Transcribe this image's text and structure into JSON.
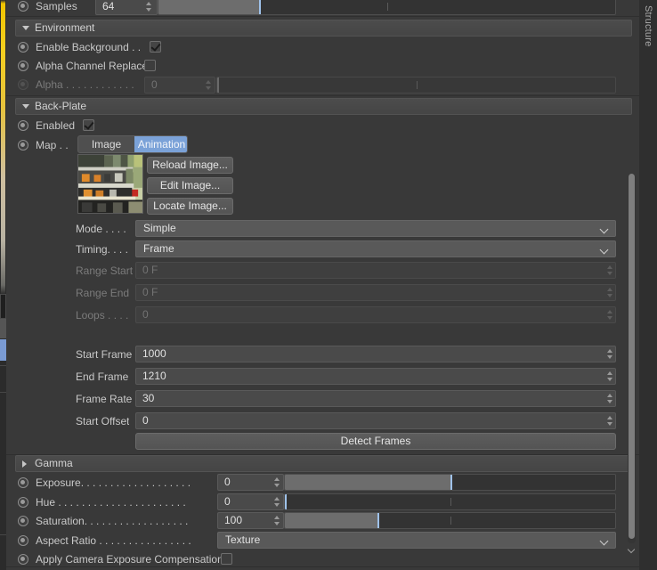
{
  "window": {
    "right_tab_label": "Structure"
  },
  "top_row": {
    "label": "Samples",
    "value": "64",
    "slider_percent": 22
  },
  "environment": {
    "group_label": "Environment",
    "rows": [
      {
        "label": "Enable Background . .",
        "checked": true
      },
      {
        "label": "Alpha Channel Replace",
        "checked": false
      }
    ],
    "alpha": {
      "label": "Alpha . . . . . . . . . . . .",
      "value": "0",
      "slider_percent": 0,
      "enabled": false
    }
  },
  "back_plate": {
    "group_label": "Back-Plate",
    "enabled": {
      "label": "Enabled",
      "checked": true
    },
    "map": {
      "label": "Map . .",
      "tabs": [
        {
          "label": "Image",
          "active": false
        },
        {
          "label": "Animation",
          "active": true
        }
      ]
    },
    "image_buttons": [
      "Reload Image...",
      "Edit Image...",
      "Locate Image..."
    ],
    "fields": [
      {
        "label": "Mode . . . .",
        "type": "dropdown",
        "value": "Simple",
        "enabled": true
      },
      {
        "label": "Timing. . . .",
        "type": "dropdown",
        "value": "Frame",
        "enabled": true
      },
      {
        "label": "Range Start",
        "type": "number",
        "value": "0 F",
        "enabled": false
      },
      {
        "label": "Range End",
        "type": "number",
        "value": "0 F",
        "enabled": false
      },
      {
        "label": "Loops . . . .",
        "type": "number",
        "value": "0",
        "enabled": false
      },
      {
        "label": "Start Frame",
        "type": "number",
        "value": "1000",
        "enabled": true
      },
      {
        "label": "End Frame",
        "type": "number",
        "value": "1210",
        "enabled": true
      },
      {
        "label": "Frame Rate",
        "type": "number",
        "value": "30",
        "enabled": true
      },
      {
        "label": "Start Offset",
        "type": "number",
        "value": "0",
        "enabled": true
      }
    ],
    "detect_frames_label": "Detect Frames"
  },
  "gamma": {
    "group_label": "Gamma",
    "collapsed": true
  },
  "color_rows": [
    {
      "label": "Exposure. . . . . . . . . . . . . . . . . . .",
      "value": "0",
      "slider_percent": 50,
      "tick_percent": 50
    },
    {
      "label": "Hue . . . . . . . . . . . . . . . . . . . . . .",
      "value": "0",
      "slider_percent": 0,
      "tick_percent": 50
    },
    {
      "label": "Saturation. . . . . . . . . . . . . . . . . .",
      "value": "100",
      "slider_percent": 28,
      "tick_percent": 50
    }
  ],
  "aspect_ratio": {
    "label": "Aspect Ratio . . . . . . . . . . . . . . . .",
    "value": "Texture"
  },
  "apply_camera_exposure": {
    "label": "Apply Camera Exposure Compensation",
    "checked": false
  },
  "colors": {
    "panel_bg": "#393939",
    "field_bg": "#4a4a4a",
    "accent_blue": "#7ba2d8",
    "slider_fill": "#6d6d6d",
    "slider_knob": "#9fc2ea"
  }
}
